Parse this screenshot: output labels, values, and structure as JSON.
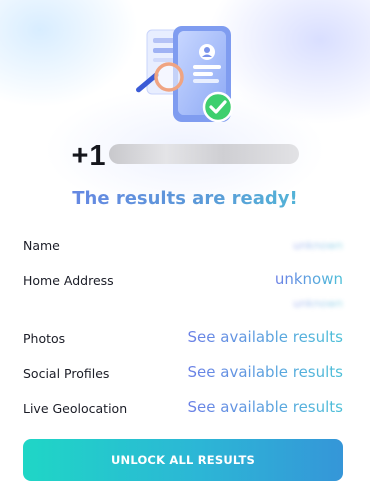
{
  "colors": {
    "accent_start": "#6b80e6",
    "accent_end": "#4cc0d8",
    "button_start": "#1fd6c6",
    "button_end": "#3596d8",
    "check_green": "#3ecf6e"
  },
  "header": {
    "illustration_icon": "phone-search-illustration",
    "phone_prefix": "+1",
    "headline": "The results are ready!"
  },
  "results": [
    {
      "label": "Name",
      "value": "unknown",
      "blurred": true
    },
    {
      "label": "Home Address",
      "value": "unknown",
      "blurred": false,
      "extra_value": "unknown",
      "extra_blurred": true
    },
    {
      "label": "Photos",
      "value": "See available results"
    },
    {
      "label": "Social Profiles",
      "value": "See available results"
    },
    {
      "label": "Live Geolocation",
      "value": "See available results"
    }
  ],
  "cta": {
    "label": "UNLOCK ALL RESULTS"
  }
}
